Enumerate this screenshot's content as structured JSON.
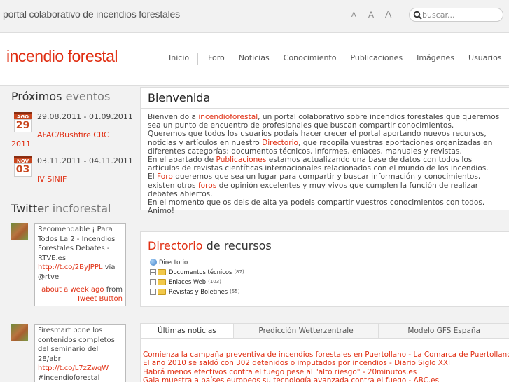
{
  "topbar": {
    "tagline": "portal colaborativo de incendios forestales",
    "font_sizes": [
      "A",
      "A",
      "A"
    ],
    "search_placeholder": "buscar..."
  },
  "header": {
    "logo": "incendio forestal",
    "nav": [
      "Inicio",
      "Foro",
      "Noticias",
      "Conocimiento",
      "Publicaciones",
      "Imágenes",
      "Usuarios"
    ]
  },
  "events": {
    "title_main": "Próximos",
    "title_sub": "eventos",
    "items": [
      {
        "month": "AGO",
        "day": "29",
        "dates": "29.08.2011 - 01.09.2011",
        "name_line1": "AFAC/Bushfire CRC",
        "name_line2": "2011"
      },
      {
        "month": "NOV",
        "day": "03",
        "dates": "03.11.2011 - 04.11.2011",
        "name_line1": "IV SINIF",
        "name_line2": ""
      }
    ]
  },
  "twitter": {
    "title_main": "Twitter",
    "title_sub": "incforestal",
    "tweets": [
      {
        "text": "Recomendable ¡ Para Todos La 2 - Incendios Forestales Debates - RTVE.es",
        "link": "http://t.co/2ByJPPL",
        "via": "vía @rtve",
        "time": "about a week ago",
        "from": "from",
        "source": "Tweet Button"
      },
      {
        "text": "Firesmart pone los contenidos completos del seminario del 28/abr",
        "link": "http://t.co/L7zZwqW",
        "tail": "#incendioforestal Muchas gracias!"
      }
    ]
  },
  "welcome": {
    "title": "Bienvenida",
    "p1_a": "Bienvenido a ",
    "p1_link": "incendioforestal",
    "p1_b": ", un portal colaborativo sobre incendios forestales que queremos sea un punto de encuentro de profesionales que buscan compartir conocimientos.",
    "p2_a": "Queremos que todos los usuarios podais hacer crecer el portal aportando nuevos recursos, noticias y artículos en nuestro ",
    "p2_link": "Directorio",
    "p2_b": ", que recopila vuestras aportaciones organizadas en diferentes categorías: documentos técnicos, informes, enlaces, manuales y revistas.",
    "p3_a": "En el apartado de ",
    "p3_link": "Publicaciones",
    "p3_b": " estamos actualizando una base de datos con todos los artículos de revistas científicas internacionales relacionados con el mundo de los incendios.",
    "p4_a": "El ",
    "p4_link1": "Foro",
    "p4_b": " queremos que sea un lugar para compartir y buscar información y conocimientos, existen otros ",
    "p4_link2": "foros",
    "p4_c": " de opinión excelentes y muy vivos que cumplen la función de realizar debates abiertos.",
    "p5": "En el momento que os deis de alta ya podeis compartir vuestros conocimientos con todos. Animo!"
  },
  "directory": {
    "title_main": "Directorio",
    "title_sub": "de recursos",
    "root": "Directorio",
    "items": [
      {
        "label": "Documentos técnicos",
        "count": "(87)"
      },
      {
        "label": "Enlaces Web",
        "count": "(103)"
      },
      {
        "label": "Revistas y Boletines",
        "count": "(55)"
      }
    ]
  },
  "tabs": [
    "Últimas noticias",
    "Predicción Wetterzentrale",
    "Modelo GFS España"
  ],
  "news": [
    "Comienza la campaña preventiva de incendios forestales en Puertollano - La Comarca de Puertollano",
    "El año 2010 se saldó con 302 detenidos o imputados por incendios - Diario Siglo XXI",
    "Habrá menos efectivos contra el fuego pese al \"alto riesgo\" - 20minutos.es",
    "Gaia muestra a países europeos su tecnología avanzada contra el fuego - ABC.es"
  ]
}
